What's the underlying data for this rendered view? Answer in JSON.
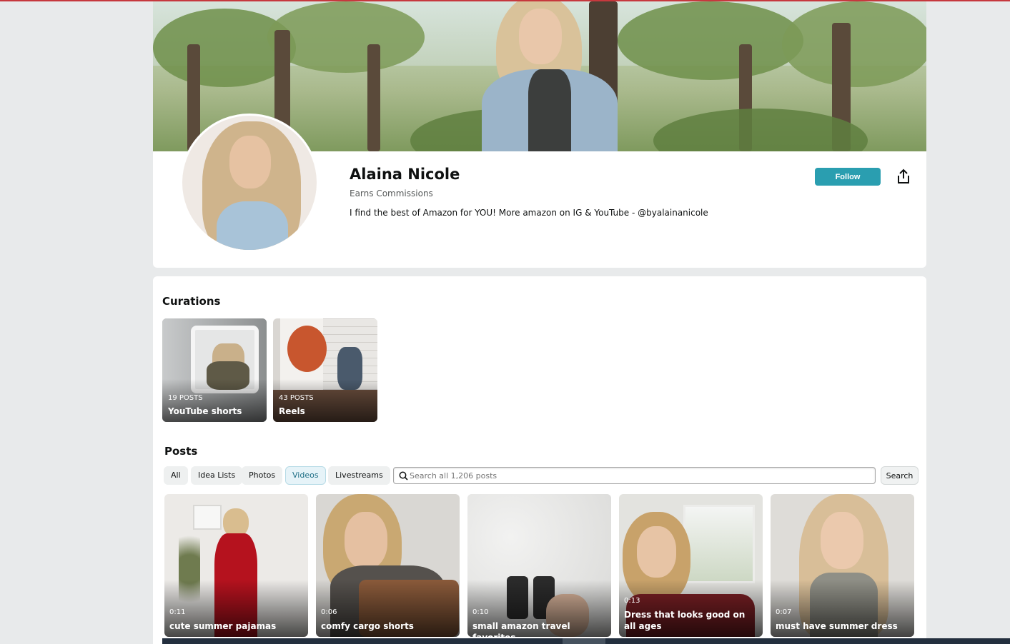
{
  "profile": {
    "name": "Alaina Nicole",
    "subtitle": "Earns Commissions",
    "bio": "I find the best of Amazon for YOU! More amazon on IG & YouTube - @byalainanicole",
    "follow_label": "Follow",
    "share_icon": "share-icon"
  },
  "curations": {
    "title": "Curations",
    "items": [
      {
        "count": "19 POSTS",
        "title": "YouTube shorts"
      },
      {
        "count": "43 POSTS",
        "title": "Reels"
      }
    ]
  },
  "posts": {
    "title": "Posts",
    "filters": [
      {
        "label": "All",
        "active": false
      },
      {
        "label": "Idea Lists",
        "active": false
      },
      {
        "label": "Photos",
        "active": false
      },
      {
        "label": "Videos",
        "active": true
      },
      {
        "label": "Livestreams",
        "active": false
      }
    ],
    "search_placeholder": "Search all 1,206 posts",
    "search_button": "Search",
    "items": [
      {
        "duration": "0:11",
        "title": "cute summer pajamas"
      },
      {
        "duration": "0:06",
        "title": "comfy cargo shorts"
      },
      {
        "duration": "0:10",
        "title": "small amazon travel favorites"
      },
      {
        "duration": "0:13",
        "title": "Dress that looks good on all ages"
      },
      {
        "duration": "0:07",
        "title": "must have summer dress"
      }
    ]
  },
  "colors": {
    "accent": "#2a9eb0",
    "background": "#e8eaeb",
    "active_filter": "#e6f3f8"
  }
}
